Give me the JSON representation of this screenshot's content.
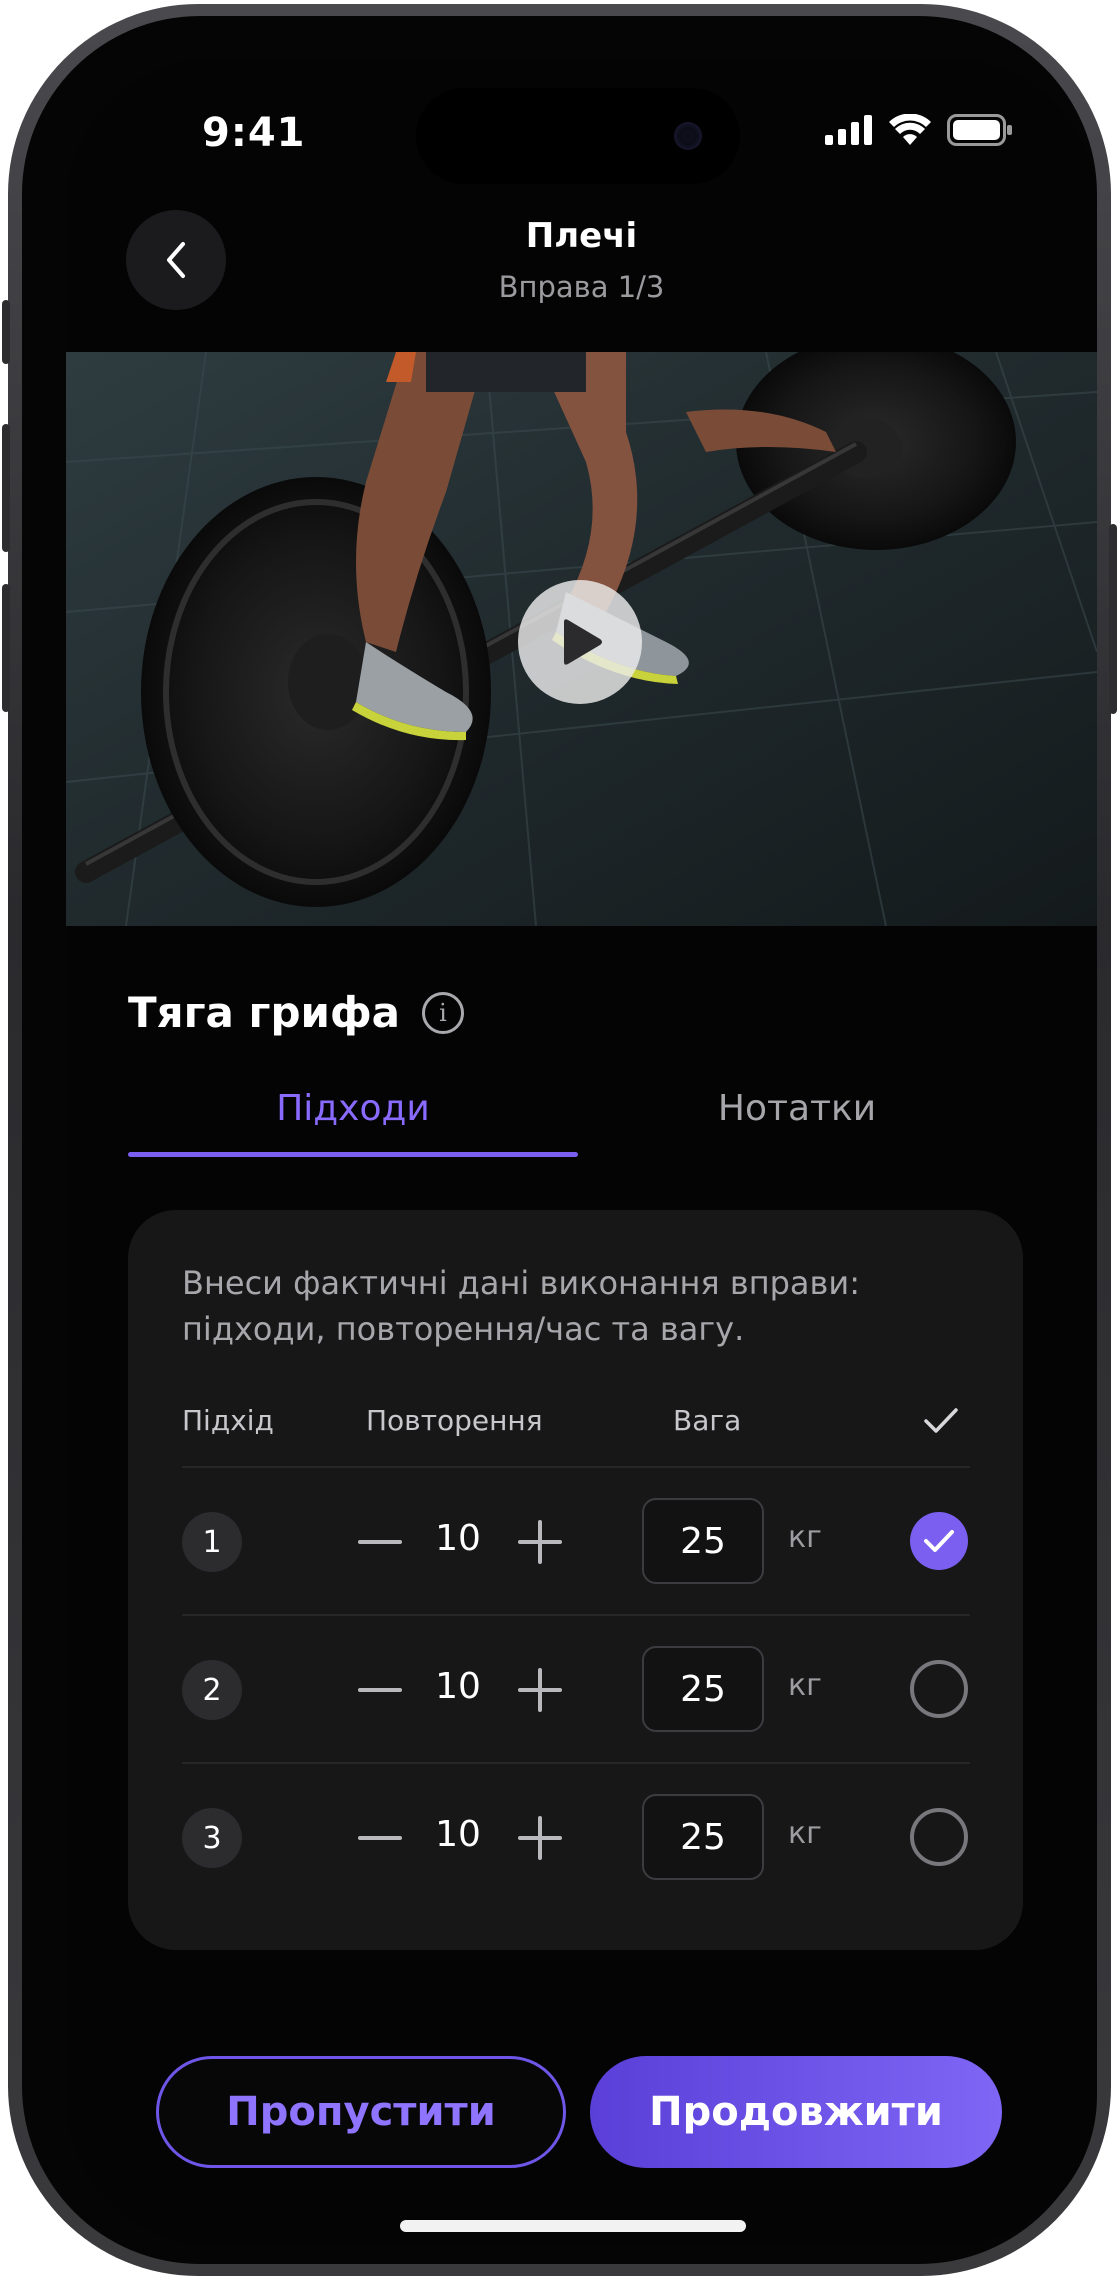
{
  "status_bar": {
    "time": "9:41"
  },
  "header": {
    "title": "Плечі",
    "subtitle": "Вправа 1/3"
  },
  "video": {
    "icon": "play-icon"
  },
  "exercise": {
    "title": "Тяга грифа",
    "info_icon": "info-icon",
    "info_glyph": "i"
  },
  "tabs": [
    {
      "label": "Підходи",
      "active": true
    },
    {
      "label": "Нотатки",
      "active": false
    }
  ],
  "sets_card": {
    "description": "Внеси фактичні дані виконання вправи: підходи, повторення/час та вагу.",
    "columns": {
      "set": "Підхід",
      "reps": "Повторення",
      "weight": "Вага",
      "done_icon": "check-icon"
    },
    "rows": [
      {
        "number": "1",
        "reps": "10",
        "weight": "25",
        "unit": "кг",
        "done": true
      },
      {
        "number": "2",
        "reps": "10",
        "weight": "25",
        "unit": "кг",
        "done": false
      },
      {
        "number": "3",
        "reps": "10",
        "weight": "25",
        "unit": "кг",
        "done": false
      }
    ]
  },
  "actions": {
    "skip_label": "Пропустити",
    "continue_label": "Продовжити"
  },
  "colors": {
    "accent": "#7a5ff0",
    "background": "#040404",
    "card": "#171718"
  }
}
